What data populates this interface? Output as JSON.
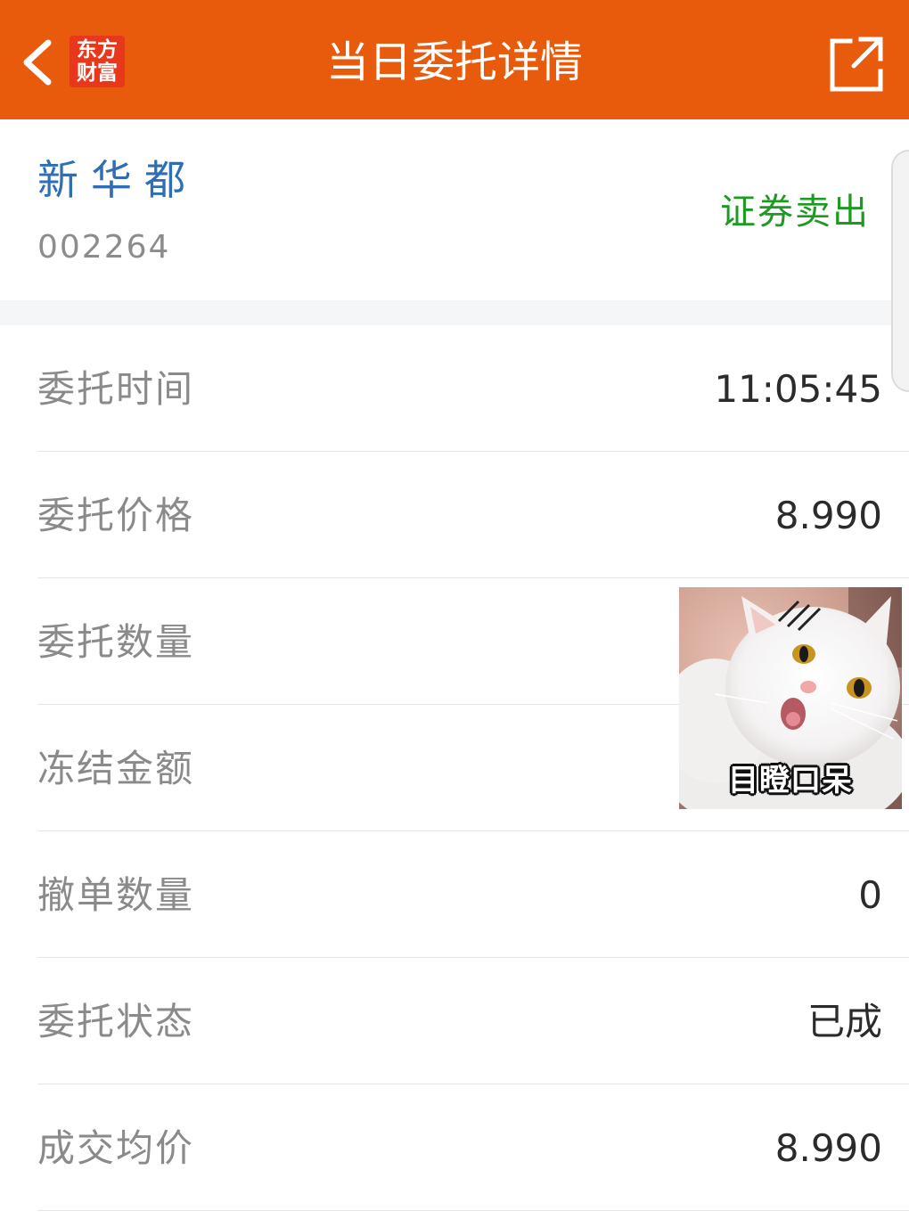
{
  "header": {
    "title": "当日委托详情",
    "logo_line1": "东方",
    "logo_line2": "财富",
    "back_icon": "chevron-left-icon",
    "share_icon": "share-external-icon",
    "background_color": "#e85a0c"
  },
  "stock": {
    "name": "新华都",
    "code": "002264",
    "trade_type": "证券卖出",
    "name_color": "#2f6db5",
    "trade_type_color": "#1e9a22"
  },
  "details": [
    {
      "label": "委托时间",
      "value": "11:05:45"
    },
    {
      "label": "委托价格",
      "value": "8.990"
    },
    {
      "label": "委托数量",
      "value": ""
    },
    {
      "label": "冻结金额",
      "value": ""
    },
    {
      "label": "撤单数量",
      "value": "0"
    },
    {
      "label": "委托状态",
      "value": "已成"
    },
    {
      "label": "成交均价",
      "value": "8.990"
    }
  ],
  "sticker": {
    "caption": "目瞪口呆",
    "icon": "shocked-white-cat-sticker"
  }
}
